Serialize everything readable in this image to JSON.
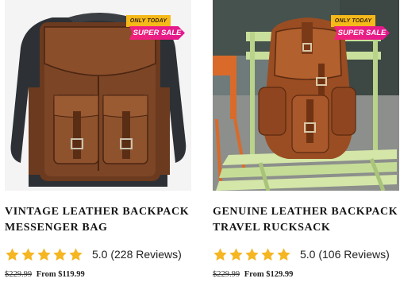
{
  "colors": {
    "star": "#f5b622",
    "badge_top": "#f5b91a",
    "badge_bottom": "#ec1f82"
  },
  "products": [
    {
      "badge_top": "ONLY TODAY",
      "badge_bottom": "SUPER SALE",
      "title_line1": "VINTAGE LEATHER BACKPACK",
      "title_line2": "MESSENGER BAG",
      "rating": 5,
      "rating_text": "5.0 (228 Reviews)",
      "old_price": "$229.99",
      "from_price": "From $119.99"
    },
    {
      "badge_top": "ONLY TODAY",
      "badge_bottom": "SUPER SALE",
      "title_line1": "GENUINE LEATHER BACKPACK",
      "title_line2": "TRAVEL RUCKSACK",
      "rating": 5,
      "rating_text": "5.0 (106 Reviews)",
      "old_price": "$229.99",
      "from_price": "From $129.99"
    }
  ]
}
